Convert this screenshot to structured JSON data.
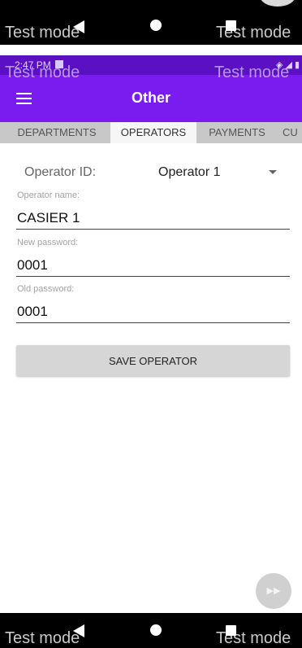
{
  "system": {
    "watermark": "Test mode",
    "status_time": "2:47 PM",
    "status_icons": "◈ ◢ ▮"
  },
  "header": {
    "title": "Other"
  },
  "tabs": [
    {
      "label": "DEPARTMENTS"
    },
    {
      "label": "OPERATORS"
    },
    {
      "label": "PAYMENTS"
    },
    {
      "label": "CU"
    }
  ],
  "form": {
    "operator_id_label": "Operator ID:",
    "operator_id_value": "Operator 1",
    "operator_name_hint": "Operator name:",
    "operator_name_value": "CASIER 1",
    "new_password_hint": "New password:",
    "new_password_value": "0001",
    "old_password_hint": "Old password:",
    "old_password_value": "0001",
    "save_label": "SAVE OPERATOR"
  },
  "fab": {
    "icon": "fast-forward-icon",
    "glyph": "▶▶"
  },
  "colors": {
    "accent": "#7a1cf0",
    "status": "#5b10c4",
    "tabs_bg": "#c8c8c8"
  }
}
